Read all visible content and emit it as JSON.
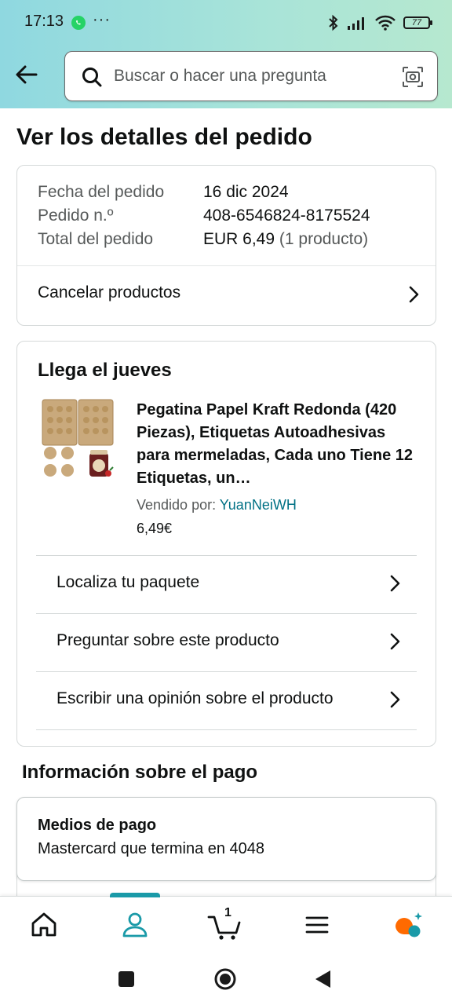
{
  "status_bar": {
    "time": "17:13",
    "overflow": "···",
    "battery": "77"
  },
  "search": {
    "placeholder": "Buscar o hacer una pregunta"
  },
  "page": {
    "title": "Ver los detalles del pedido"
  },
  "order_summary": {
    "date_label": "Fecha del pedido",
    "date_value": "16 dic 2024",
    "number_label": "Pedido n.º",
    "number_value": "408-6546824-8175524",
    "total_label": "Total del pedido",
    "total_value": "EUR 6,49",
    "total_count": "(1 producto)",
    "cancel_label": "Cancelar productos"
  },
  "shipment": {
    "heading": "Llega el jueves",
    "product_title": "Pegatina Papel Kraft Redonda (420 Piezas), Etiquetas Autoadhesivas para mermeladas, Cada uno Tiene 12 Etiquetas, un…",
    "sold_by_label": "Vendido por:",
    "seller": "YuanNeiWH",
    "price": "6,49€",
    "actions": [
      {
        "label": "Localiza tu paquete"
      },
      {
        "label": "Preguntar sobre este producto"
      },
      {
        "label": "Escribir una opinión sobre el producto"
      }
    ]
  },
  "payment": {
    "heading": "Información sobre el pago",
    "method_label": "Medios de pago",
    "method_value": "Mastercard  que termina en 4048"
  },
  "bottom_nav": {
    "cart_count": "1"
  },
  "colors": {
    "accent": "#007185",
    "nav_indicator": "#1a9aa8",
    "header_start": "#8fd8e0",
    "header_end": "#b6e8cf",
    "rufus": "#ff6a00"
  }
}
